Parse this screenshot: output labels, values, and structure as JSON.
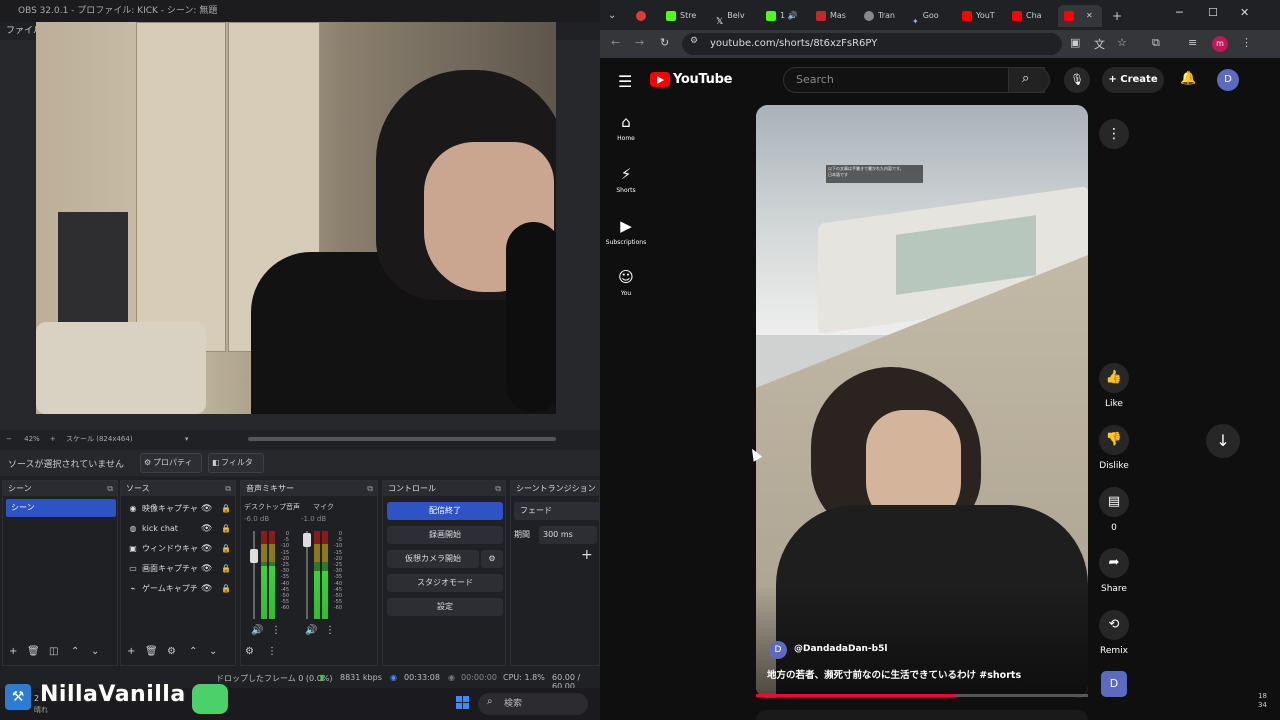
{
  "obs": {
    "title": "OBS 32.0.1 - プロファイル: KICK - シーン: 無題",
    "menu": "ファイル(F",
    "zoom": "42%",
    "scale": "スケール (824x464)",
    "no_source": "ソースが選択されていません",
    "properties_label": "プロパティ",
    "filters_label": "フィルタ",
    "docks": {
      "scenes": "シーン",
      "sources": "ソース",
      "mixer": "音声ミキサー",
      "controls": "コントロール",
      "transitions": "シーントランジション"
    },
    "scene_items": [
      "シーン"
    ],
    "sources": [
      {
        "name": "映像キャプチャデ",
        "icon": "camera-icon"
      },
      {
        "name": "kick chat",
        "icon": "globe-icon"
      },
      {
        "name": "ウィンドウキャプチ",
        "icon": "window-icon"
      },
      {
        "name": "画面キャプチャ",
        "icon": "monitor-icon"
      },
      {
        "name": "ゲームキャプチャ",
        "icon": "gamepad-icon"
      }
    ],
    "mixer": [
      {
        "name": "デスクトップ音声",
        "db": "-6.0 dB",
        "level": 0.6
      },
      {
        "name": "マイク",
        "db": "-1.0 dB",
        "level": 0.55
      }
    ],
    "meter_scale": [
      "0",
      "-5",
      "-10",
      "-15",
      "-20",
      "-25",
      "-30",
      "-35",
      "-40",
      "-45",
      "-50",
      "-55",
      "-60"
    ],
    "controls": {
      "stop_stream": "配信終了",
      "start_record": "録画開始",
      "virtual_cam": "仮想カメラ開始",
      "studio_mode": "スタジオモード",
      "settings": "設定"
    },
    "transition": {
      "type": "フェード",
      "duration_label": "期間",
      "duration": "300 ms"
    },
    "status": {
      "dropped": "ドロップしたフレーム 0 (0.0%)",
      "bitrate": "8831 kbps",
      "stream_time": "00:33:08",
      "rec_time": "00:00:00",
      "cpu": "CPU: 1.8%",
      "fps": "60.00 / 60.00"
    }
  },
  "overlay": {
    "name": "NillaVanilla :"
  },
  "taskbar": {
    "search": "検索",
    "weather_left": "2",
    "weather_sub": "晴れ"
  },
  "browser": {
    "tabs": [
      "Stre",
      "Belv",
      "1",
      "Mas",
      "Tran",
      "Goo",
      "YouT",
      "Cha"
    ],
    "url": "youtube.com/shorts/8t6xzFsR6PY",
    "profile": "m"
  },
  "youtube": {
    "logo": "YouTube",
    "search_placeholder": "Search",
    "create": "Create",
    "avatar": "D",
    "nav": [
      {
        "label": "Home",
        "icon": "home-icon"
      },
      {
        "label": "Shorts",
        "icon": "shorts-icon"
      },
      {
        "label": "Subscriptions",
        "icon": "subscriptions-icon"
      },
      {
        "label": "You",
        "icon": "you-icon"
      }
    ],
    "short": {
      "overlay_text": "以下の文章は手書きで書かれた内容です。\n日本語です",
      "channel": "@DandadaDan-b5l",
      "channel_initial": "D",
      "title": "地方の若者、瀕死寸前なのに生活できているわけ  #shorts",
      "progress": 0.6
    },
    "actions": {
      "like": "Like",
      "dislike": "Dislike",
      "comments": "0",
      "share": "Share",
      "remix": "Remix"
    },
    "remix_avatar": "D"
  },
  "clock": {
    "line1": "18",
    "line2": "34"
  }
}
